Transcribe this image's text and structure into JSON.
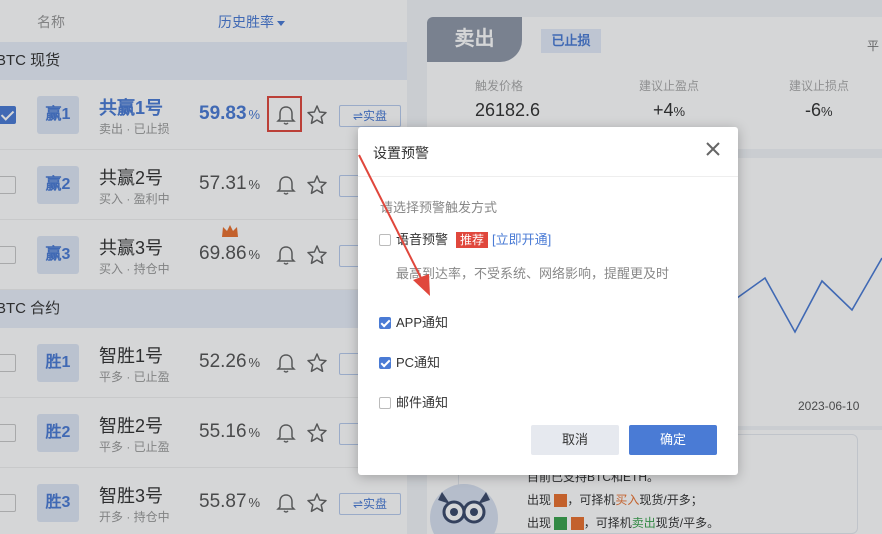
{
  "list": {
    "col_name": "名称",
    "col_rate": "历史胜率",
    "groups": [
      {
        "title": "BTC 现货",
        "rows": [
          {
            "badge": "赢1",
            "name": "共赢1号",
            "sub": "卖出 · 已止损",
            "rate": "59.83",
            "pct": "%",
            "checked": true,
            "active": true,
            "real": "⇌实盘"
          },
          {
            "badge": "赢2",
            "name": "共赢2号",
            "sub": "买入 · 盈利中",
            "rate": "57.31",
            "pct": "%",
            "checked": false,
            "active": false,
            "real": "⇌"
          },
          {
            "badge": "赢3",
            "name": "共赢3号",
            "sub": "买入 · 持仓中",
            "rate": "69.86",
            "pct": "%",
            "checked": false,
            "active": false,
            "real": "⇌"
          }
        ]
      },
      {
        "title": "BTC 合约",
        "rows": [
          {
            "badge": "胜1",
            "name": "智胜1号",
            "sub": "平多 · 已止盈",
            "rate": "52.26",
            "pct": "%",
            "checked": false,
            "active": false,
            "real": "⇌"
          },
          {
            "badge": "胜2",
            "name": "智胜2号",
            "sub": "平多 · 已止盈",
            "rate": "55.16",
            "pct": "%",
            "checked": false,
            "active": false,
            "real": "⇌"
          },
          {
            "badge": "胜3",
            "name": "智胜3号",
            "sub": "开多 · 持仓中",
            "rate": "55.87",
            "pct": "%",
            "checked": false,
            "active": false,
            "real": "⇌实盘"
          }
        ]
      }
    ]
  },
  "signal": {
    "side": "卖出",
    "status": "已止损",
    "flat": "平",
    "trigger_label": "触发价格",
    "trigger_value": "26182.6",
    "tp_label": "建议止盈点",
    "tp_value": "+4",
    "sl_label": "建议止损点",
    "sl_value": "-6",
    "pct": "%",
    "chart_date": "2023-06-10"
  },
  "note": {
    "line1": "目前已支持BTC和ETH。",
    "line2_pre": "出现",
    "line2_mid": "，可择机",
    "line2_action": "买入",
    "line2_post": "现货/开多；",
    "line3_pre": "出现",
    "line3_mid": "，可择机",
    "line3_action": "卖出",
    "line3_post": "现货/平多。"
  },
  "dialog": {
    "title": "设置预警",
    "prompt": "请选择预警触发方式",
    "voice_label": "语音预警",
    "voice_tag": "推荐",
    "voice_link": "[立即开通]",
    "voice_desc": "最高到达率，不受系统、网络影响，提醒更及时",
    "app_label": "APP通知",
    "pc_label": "PC通知",
    "mail_label": "邮件通知",
    "cancel": "取消",
    "ok": "确定"
  },
  "colors": {
    "accent": "#4a7bd5",
    "alert_red": "#e0473c",
    "up_orange": "#e9712f",
    "down_green": "#3aa34e"
  }
}
